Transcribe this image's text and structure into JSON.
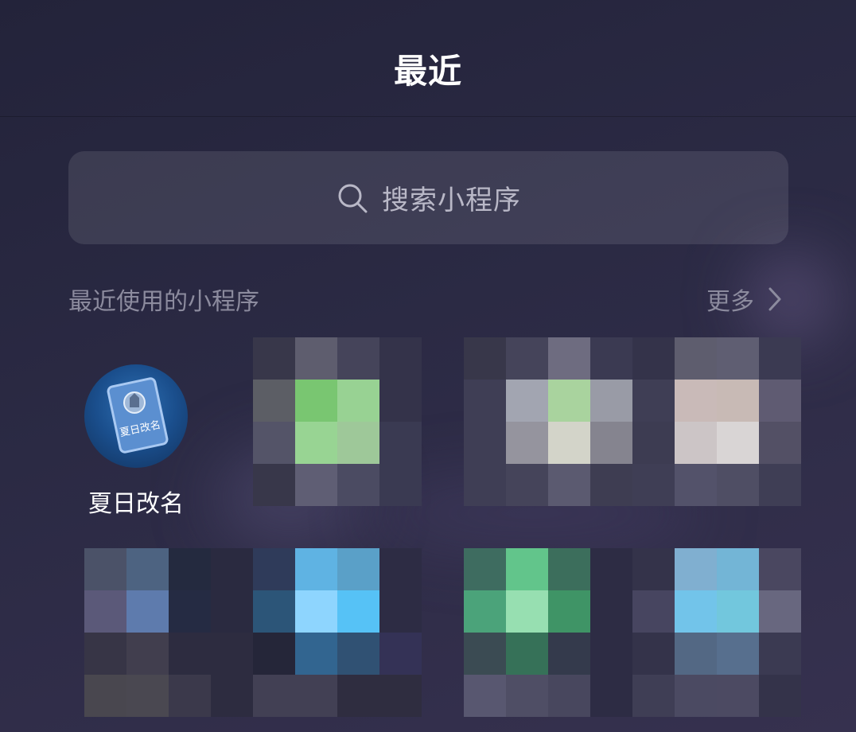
{
  "header": {
    "title": "最近"
  },
  "search": {
    "placeholder": "搜索小程序"
  },
  "recent": {
    "section_title": "最近使用的小程序",
    "more_label": "更多"
  },
  "apps": [
    {
      "label": "夏日改名",
      "icon_text": "夏日改名",
      "icon": "mini-program-icon",
      "pixelated": false
    }
  ],
  "pixelated_tiles": [
    {
      "icon": "pixelated-mini-program-icon",
      "colors": [
        "#38374a",
        "#5e5d6e",
        "#45445a",
        "#34334a",
        "#5c5e65",
        "#79c671",
        "#98d293",
        "#34334a",
        "#545468",
        "#98d493",
        "#9ec899",
        "#3a3a52",
        "#38374a",
        "#5f5e74",
        "#4b4b62",
        "#3a3a52"
      ]
    },
    {
      "icon": "pixelated-mini-program-icon",
      "colors": [
        "#38374a",
        "#45445a",
        "#6e6c80",
        "#3b3a52",
        "#3f3e55",
        "#a2a5b1",
        "#a9d39e",
        "#999ba6",
        "#3f3e55",
        "#95949e",
        "#d3d4c9",
        "#85848f",
        "#3f3e55",
        "#45445a",
        "#5b5a70",
        "#3e3d52"
      ]
    },
    {
      "icon": "pixelated-mini-program-icon",
      "colors": [
        "#34334a",
        "#5e5d6e",
        "#5f5e72",
        "#3b3a52",
        "#3f3e55",
        "#c9bab8",
        "#c8bab5",
        "#5f5b72",
        "#3d3c52",
        "#ccc5c6",
        "#d9d5d5",
        "#535065",
        "#3f3e55",
        "#53526a",
        "#4f4e64",
        "#3f3e55"
      ]
    },
    {
      "icon": "pixelated-mini-program-icon",
      "colors": [
        "#4b5268",
        "#4d6381",
        "#242a3f",
        "#2a2a40",
        "#5b5979",
        "#5e7bad",
        "#252b43",
        "#2a2a40",
        "#373546",
        "#413e4e",
        "#2d2c40",
        "#2d2c40",
        "#49474f",
        "#4a4851",
        "#3b394b",
        "#2d2c40"
      ]
    },
    {
      "icon": "pixelated-mini-program-icon",
      "colors": [
        "#2f3b5a",
        "#5fb3e3",
        "#5aa0c8",
        "#2d2c44",
        "#2c5578",
        "#8ed5fe",
        "#56c2f6",
        "#2d2c44",
        "#252639",
        "#326590",
        "#305173",
        "#343256",
        "#424054",
        "#424054",
        "#2f2d40",
        "#2f2d40"
      ]
    },
    {
      "icon": "pixelated-mini-program-icon",
      "colors": [
        "#3e6c60",
        "#62c58b",
        "#3c6e5c",
        "#2d2c44",
        "#4ba37a",
        "#97dfb1",
        "#3f9466",
        "#2d2c44",
        "#3b4b53",
        "#367158",
        "#343a4c",
        "#2d2c44",
        "#585770",
        "#4f4e65",
        "#48475e",
        "#2d2c44"
      ]
    },
    {
      "icon": "pixelated-mini-program-icon",
      "colors": [
        "#34334a",
        "#80afd0",
        "#73b5d6",
        "#4a4760",
        "#474560",
        "#72c4ea",
        "#72c7dd",
        "#68677f",
        "#34334a",
        "#536884",
        "#576f8e",
        "#3b3a52",
        "#3f3e55",
        "#4b4a62",
        "#4c4a62",
        "#34334a"
      ]
    }
  ],
  "colors": {
    "background_top": "#23233a",
    "background_bottom": "#36314f",
    "search_bg": "rgba(255,255,255,0.10)",
    "text_primary": "#ffffff",
    "text_secondary": "#8c8b9e"
  }
}
